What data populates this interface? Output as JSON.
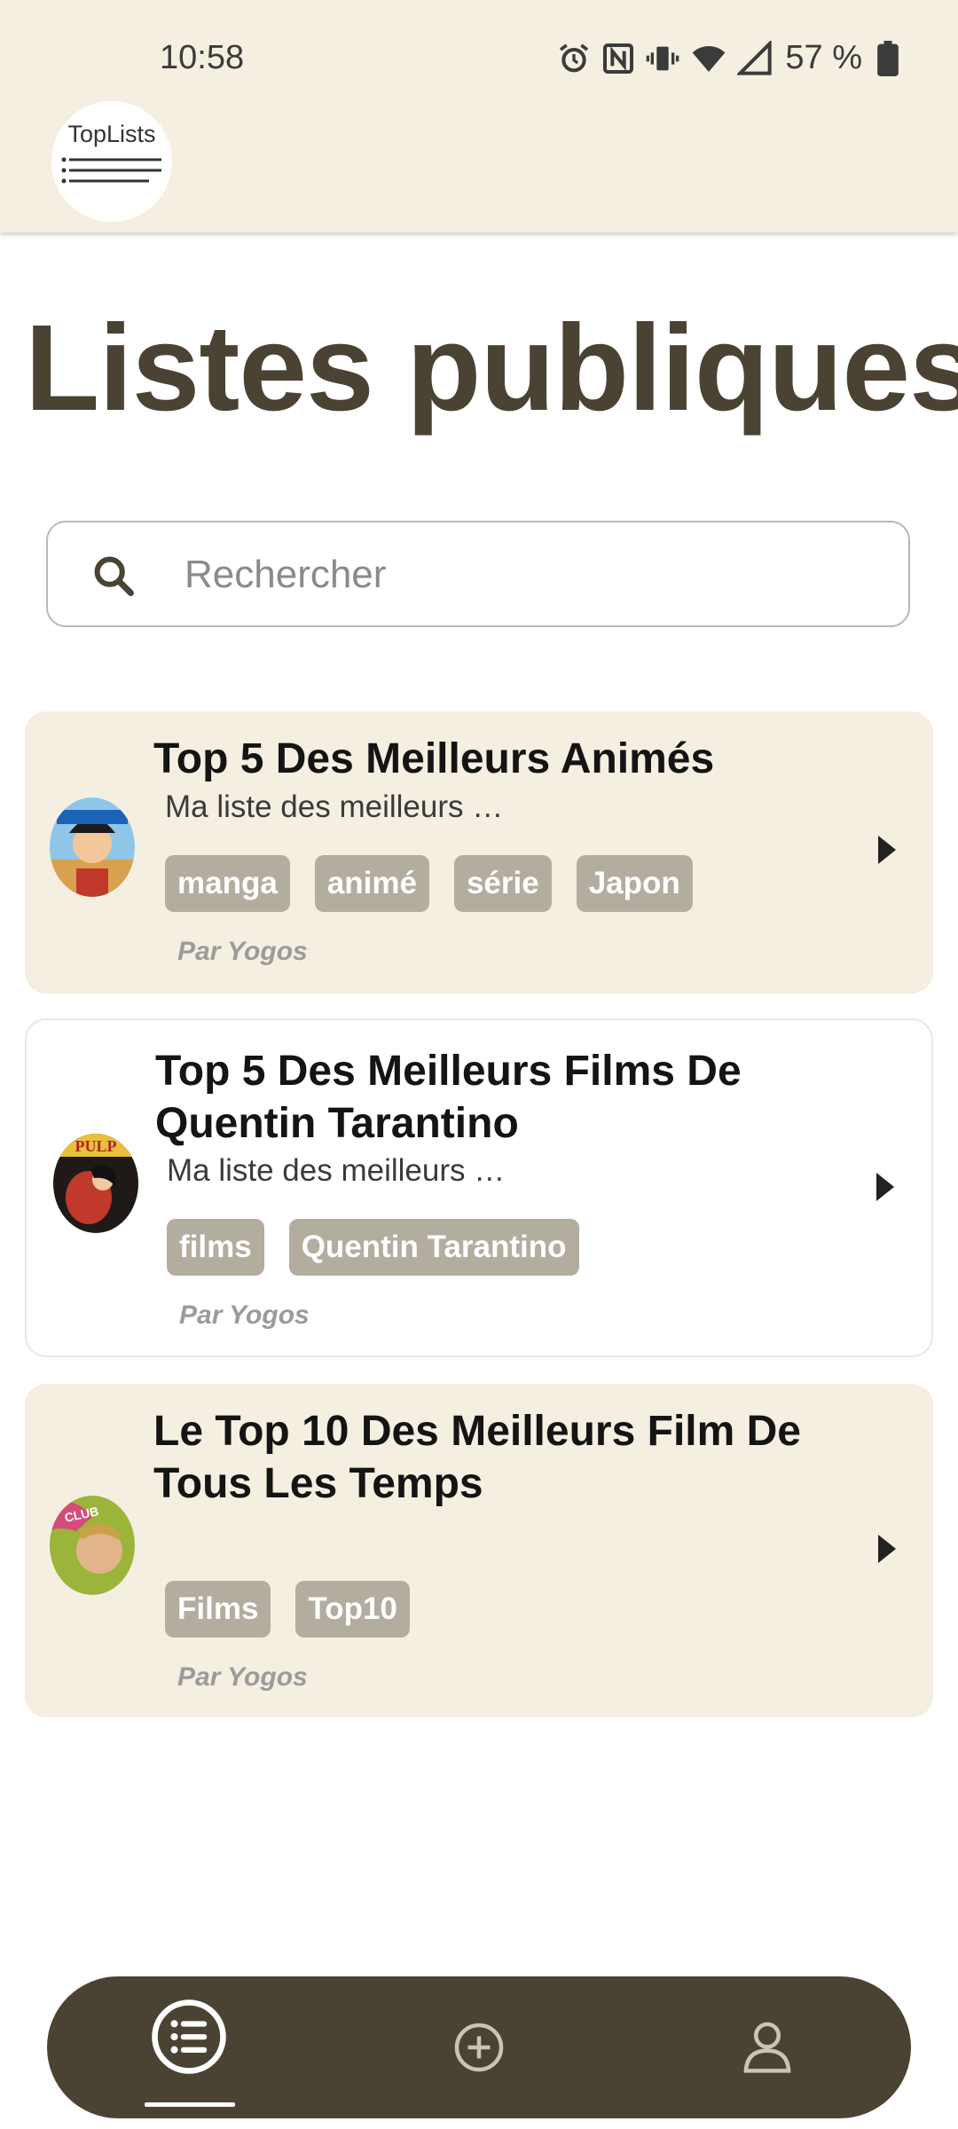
{
  "status_bar": {
    "time": "10:58",
    "battery_percent": "57 %",
    "icons": [
      "alarm-icon",
      "nfc-icon",
      "vibrate-icon",
      "wifi-icon",
      "signal-icon",
      "battery-icon"
    ]
  },
  "app": {
    "logo_text": "TopLists"
  },
  "page": {
    "title": "Listes publiques"
  },
  "search": {
    "placeholder": "Rechercher",
    "value": ""
  },
  "lists": [
    {
      "title": "Top 5 Des Meilleurs Animés",
      "description": "Ma liste des meilleurs …",
      "tags": [
        "manga",
        "animé",
        "série",
        "Japon"
      ],
      "author": "Par Yogos",
      "style": "tinted"
    },
    {
      "title": "Top 5 Des Meilleurs Films De Quentin Tarantino",
      "description": "Ma liste des meilleurs …",
      "tags": [
        "films",
        "Quentin Tarantino"
      ],
      "author": "Par Yogos",
      "style": "outlined"
    },
    {
      "title": "Le Top 10 Des Meilleurs Film De Tous Les Temps",
      "description": "",
      "tags": [
        "Films",
        "Top10"
      ],
      "author": "Par Yogos",
      "style": "tinted"
    }
  ],
  "bottom_nav": {
    "items": [
      "list-icon",
      "add-icon",
      "profile-icon"
    ],
    "active_index": 0
  },
  "colors": {
    "header_bg": "#f5efe1",
    "title": "#4a4334",
    "tag_bg": "#b3ada0",
    "nav_bg": "#4a4334"
  }
}
